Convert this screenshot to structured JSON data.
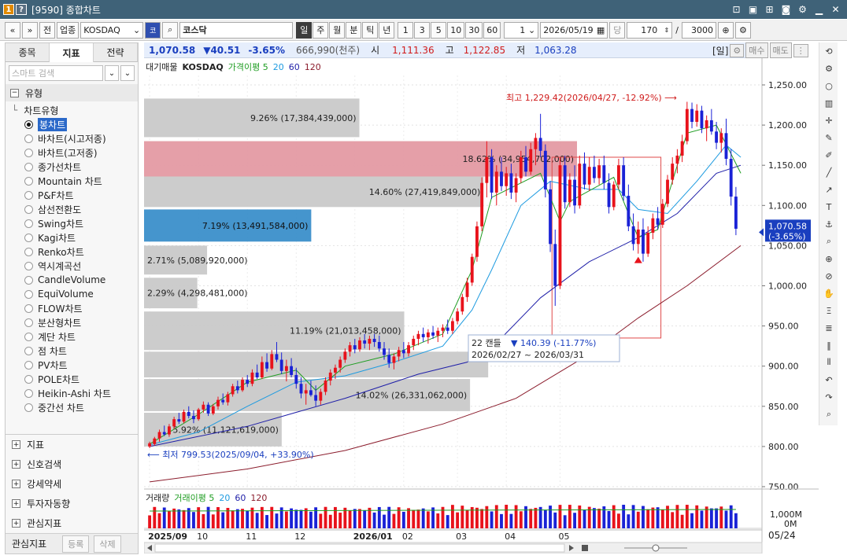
{
  "window": {
    "title": "[9590] 종합차트",
    "badge_one": "1",
    "badge_two": "?"
  },
  "toolbar": {
    "prev": "«",
    "next": "»",
    "all": "전",
    "sector": "업종",
    "symbol": "KOSDAQ",
    "code_btn": "코",
    "market_name": "코스닥",
    "periods": [
      "일",
      "주",
      "월",
      "분",
      "틱",
      "년"
    ],
    "active_period": "일",
    "intervals": [
      "1",
      "3",
      "5",
      "10",
      "30",
      "60"
    ],
    "count_select": "1",
    "date": "2026/05/19",
    "per_label": "당",
    "bar_count": "170",
    "slash": "/",
    "total_count": "3000"
  },
  "left_panel": {
    "tabs": [
      "종목",
      "지표",
      "전략"
    ],
    "active_tab": "지표",
    "search_placeholder": "스마트 검색",
    "section_title": "유형",
    "category": "차트유형",
    "chart_types": [
      "봉차트",
      "바차트(시고저종)",
      "바차트(고저종)",
      "종가선차트",
      "Mountain 차트",
      "P&F차트",
      "삼선전환도",
      "Swing차트",
      "Kagi차트",
      "Renko차트",
      "역시계곡선",
      "CandleVolume",
      "EquiVolume",
      "FLOW차트",
      "분산형차트",
      "계단 차트",
      "점 차트",
      "PV차트",
      "POLE차트",
      "Heikin-Ashi 차트",
      "중간선 차트"
    ],
    "selected_type": "봉차트",
    "groups": [
      "지표",
      "신호검색",
      "강세약세",
      "투자자동향",
      "관심지표"
    ],
    "bottom_label": "관심지표",
    "bottom_buttons": [
      "등록",
      "삭제"
    ]
  },
  "price_bar": {
    "last": "1,070.58",
    "change": "▼40.51",
    "change_pct": "-3.65%",
    "volume": "666,990(천주)",
    "open_label": "시",
    "open": "1,111.36",
    "high_label": "고",
    "high": "1,122.85",
    "low_label": "저",
    "low": "1,063.28",
    "period_tag": "[일]",
    "buy_label": "매수",
    "sell_label": "매도"
  },
  "legend": {
    "profile": "대기매물",
    "symbol": "KOSDAQ",
    "ma_label": "가격이평 5",
    "ma20": "20",
    "ma60": "60",
    "ma120": "120"
  },
  "volume_legend": {
    "title": "거래량",
    "ma_label": "거래이평 5",
    "ma20": "20",
    "ma60": "60",
    "ma120": "120"
  },
  "annotations": {
    "high": "최고 1,229.42(2026/04/27, -12.92%)",
    "low": "최저 799.53(2025/09/04, +33.90%)",
    "range_line1": "22 캔들",
    "range_change": "140.39 (-11.77%)",
    "range_line2": "2026/02/27 ~ 2026/03/31"
  },
  "last_price_tag": {
    "price": "1,070.58",
    "pct": "(-3.65%)"
  },
  "volume_axis": [
    "1,000M",
    "0M"
  ],
  "date_box": "05/24",
  "colors": {
    "up": "#e8121b",
    "down": "#1a22d6",
    "ma5": "#1f9d22",
    "ma20": "#1e9be0",
    "ma60": "#1f1fa8",
    "ma120": "#8b1c2c",
    "profile_gray": "#c9c9c9",
    "profile_red": "#e49aa3",
    "profile_blue": "#3b8fca"
  },
  "chart_data": {
    "type": "candlestick",
    "price_axis": {
      "min": 750,
      "max": 1250,
      "ticks": [
        750,
        800,
        850,
        900,
        950,
        1000,
        1050,
        1100,
        1150,
        1200,
        1250
      ]
    },
    "x_labels": [
      "2025/09",
      "10",
      "11",
      "12",
      "2026/01",
      "02",
      "03",
      "04",
      "05"
    ],
    "candles": [
      {
        "o": 800,
        "h": 806,
        "l": 798,
        "c": 804
      },
      {
        "o": 803,
        "h": 812,
        "l": 801,
        "c": 810
      },
      {
        "o": 810,
        "h": 821,
        "l": 806,
        "c": 818
      },
      {
        "o": 818,
        "h": 826,
        "l": 813,
        "c": 815
      },
      {
        "o": 815,
        "h": 828,
        "l": 812,
        "c": 825
      },
      {
        "o": 825,
        "h": 837,
        "l": 822,
        "c": 834
      },
      {
        "o": 834,
        "h": 842,
        "l": 828,
        "c": 831
      },
      {
        "o": 831,
        "h": 846,
        "l": 829,
        "c": 843
      },
      {
        "o": 843,
        "h": 850,
        "l": 835,
        "c": 838
      },
      {
        "o": 838,
        "h": 845,
        "l": 829,
        "c": 834
      },
      {
        "o": 834,
        "h": 848,
        "l": 832,
        "c": 846
      },
      {
        "o": 846,
        "h": 856,
        "l": 842,
        "c": 852
      },
      {
        "o": 852,
        "h": 855,
        "l": 838,
        "c": 841
      },
      {
        "o": 841,
        "h": 853,
        "l": 839,
        "c": 850
      },
      {
        "o": 850,
        "h": 862,
        "l": 846,
        "c": 858
      },
      {
        "o": 858,
        "h": 866,
        "l": 852,
        "c": 855
      },
      {
        "o": 855,
        "h": 868,
        "l": 851,
        "c": 865
      },
      {
        "o": 865,
        "h": 878,
        "l": 862,
        "c": 875
      },
      {
        "o": 875,
        "h": 882,
        "l": 866,
        "c": 870
      },
      {
        "o": 870,
        "h": 886,
        "l": 868,
        "c": 883
      },
      {
        "o": 883,
        "h": 889,
        "l": 874,
        "c": 878
      },
      {
        "o": 878,
        "h": 896,
        "l": 875,
        "c": 892
      },
      {
        "o": 892,
        "h": 902,
        "l": 884,
        "c": 886
      },
      {
        "o": 886,
        "h": 912,
        "l": 884,
        "c": 905
      },
      {
        "o": 905,
        "h": 916,
        "l": 893,
        "c": 897
      },
      {
        "o": 897,
        "h": 920,
        "l": 895,
        "c": 915
      },
      {
        "o": 915,
        "h": 930,
        "l": 905,
        "c": 908
      },
      {
        "o": 908,
        "h": 917,
        "l": 890,
        "c": 894
      },
      {
        "o": 894,
        "h": 908,
        "l": 881,
        "c": 900
      },
      {
        "o": 900,
        "h": 910,
        "l": 886,
        "c": 889
      },
      {
        "o": 889,
        "h": 898,
        "l": 872,
        "c": 878
      },
      {
        "o": 878,
        "h": 886,
        "l": 860,
        "c": 866
      },
      {
        "o": 866,
        "h": 878,
        "l": 852,
        "c": 870
      },
      {
        "o": 870,
        "h": 882,
        "l": 862,
        "c": 864
      },
      {
        "o": 864,
        "h": 876,
        "l": 850,
        "c": 857
      },
      {
        "o": 857,
        "h": 872,
        "l": 852,
        "c": 868
      },
      {
        "o": 868,
        "h": 886,
        "l": 864,
        "c": 882
      },
      {
        "o": 882,
        "h": 896,
        "l": 876,
        "c": 892
      },
      {
        "o": 892,
        "h": 902,
        "l": 884,
        "c": 898
      },
      {
        "o": 898,
        "h": 912,
        "l": 892,
        "c": 908
      },
      {
        "o": 908,
        "h": 922,
        "l": 904,
        "c": 918
      },
      {
        "o": 918,
        "h": 930,
        "l": 912,
        "c": 926
      },
      {
        "o": 926,
        "h": 934,
        "l": 916,
        "c": 921
      },
      {
        "o": 921,
        "h": 936,
        "l": 918,
        "c": 932
      },
      {
        "o": 932,
        "h": 940,
        "l": 922,
        "c": 928
      },
      {
        "o": 928,
        "h": 938,
        "l": 920,
        "c": 934
      },
      {
        "o": 934,
        "h": 940,
        "l": 924,
        "c": 930
      },
      {
        "o": 930,
        "h": 938,
        "l": 918,
        "c": 922
      },
      {
        "o": 922,
        "h": 930,
        "l": 908,
        "c": 914
      },
      {
        "o": 914,
        "h": 922,
        "l": 898,
        "c": 904
      },
      {
        "o": 904,
        "h": 916,
        "l": 896,
        "c": 912
      },
      {
        "o": 912,
        "h": 924,
        "l": 906,
        "c": 920
      },
      {
        "o": 920,
        "h": 930,
        "l": 910,
        "c": 916
      },
      {
        "o": 916,
        "h": 930,
        "l": 912,
        "c": 926
      },
      {
        "o": 926,
        "h": 938,
        "l": 920,
        "c": 934
      },
      {
        "o": 934,
        "h": 944,
        "l": 926,
        "c": 940
      },
      {
        "o": 940,
        "h": 948,
        "l": 930,
        "c": 936
      },
      {
        "o": 936,
        "h": 946,
        "l": 928,
        "c": 942
      },
      {
        "o": 942,
        "h": 950,
        "l": 934,
        "c": 938
      },
      {
        "o": 938,
        "h": 948,
        "l": 930,
        "c": 944
      },
      {
        "o": 944,
        "h": 952,
        "l": 936,
        "c": 948
      },
      {
        "o": 948,
        "h": 958,
        "l": 940,
        "c": 944
      },
      {
        "o": 944,
        "h": 960,
        "l": 940,
        "c": 956
      },
      {
        "o": 956,
        "h": 972,
        "l": 952,
        "c": 968
      },
      {
        "o": 968,
        "h": 990,
        "l": 964,
        "c": 986
      },
      {
        "o": 986,
        "h": 1010,
        "l": 980,
        "c": 1004
      },
      {
        "o": 1004,
        "h": 1040,
        "l": 1000,
        "c": 1036
      },
      {
        "o": 1036,
        "h": 1080,
        "l": 1030,
        "c": 1074
      },
      {
        "o": 1074,
        "h": 1135,
        "l": 1068,
        "c": 1128
      },
      {
        "o": 1128,
        "h": 1180,
        "l": 1110,
        "c": 1160
      },
      {
        "o": 1160,
        "h": 1170,
        "l": 1108,
        "c": 1116
      },
      {
        "o": 1116,
        "h": 1150,
        "l": 1100,
        "c": 1142
      },
      {
        "o": 1142,
        "h": 1160,
        "l": 1118,
        "c": 1124
      },
      {
        "o": 1124,
        "h": 1148,
        "l": 1112,
        "c": 1140
      },
      {
        "o": 1140,
        "h": 1152,
        "l": 1108,
        "c": 1116
      },
      {
        "o": 1116,
        "h": 1140,
        "l": 1104,
        "c": 1134
      },
      {
        "o": 1134,
        "h": 1168,
        "l": 1128,
        "c": 1160
      },
      {
        "o": 1160,
        "h": 1174,
        "l": 1136,
        "c": 1142
      },
      {
        "o": 1142,
        "h": 1178,
        "l": 1138,
        "c": 1170
      },
      {
        "o": 1170,
        "h": 1190,
        "l": 1150,
        "c": 1184
      },
      {
        "o": 1184,
        "h": 1214,
        "l": 1160,
        "c": 1168
      },
      {
        "o": 1168,
        "h": 1176,
        "l": 1110,
        "c": 1120
      },
      {
        "o": 1120,
        "h": 1130,
        "l": 1042,
        "c": 1052
      },
      {
        "o": 1052,
        "h": 1070,
        "l": 975,
        "c": 1000
      },
      {
        "o": 1000,
        "h": 1160,
        "l": 996,
        "c": 1150
      },
      {
        "o": 1150,
        "h": 1162,
        "l": 1096,
        "c": 1104
      },
      {
        "o": 1104,
        "h": 1140,
        "l": 1098,
        "c": 1132
      },
      {
        "o": 1132,
        "h": 1150,
        "l": 1090,
        "c": 1100
      },
      {
        "o": 1100,
        "h": 1162,
        "l": 1096,
        "c": 1152
      },
      {
        "o": 1152,
        "h": 1166,
        "l": 1120,
        "c": 1126
      },
      {
        "o": 1126,
        "h": 1160,
        "l": 1118,
        "c": 1148
      },
      {
        "o": 1148,
        "h": 1162,
        "l": 1128,
        "c": 1134
      },
      {
        "o": 1134,
        "h": 1158,
        "l": 1126,
        "c": 1150
      },
      {
        "o": 1150,
        "h": 1162,
        "l": 1120,
        "c": 1128
      },
      {
        "o": 1128,
        "h": 1140,
        "l": 1090,
        "c": 1098
      },
      {
        "o": 1098,
        "h": 1130,
        "l": 1094,
        "c": 1126
      },
      {
        "o": 1126,
        "h": 1158,
        "l": 1120,
        "c": 1150
      },
      {
        "o": 1150,
        "h": 1160,
        "l": 1106,
        "c": 1112
      },
      {
        "o": 1112,
        "h": 1126,
        "l": 1068,
        "c": 1074
      },
      {
        "o": 1074,
        "h": 1090,
        "l": 1044,
        "c": 1052
      },
      {
        "o": 1052,
        "h": 1080,
        "l": 1040,
        "c": 1070
      },
      {
        "o": 1070,
        "h": 1084,
        "l": 1030,
        "c": 1040
      },
      {
        "o": 1040,
        "h": 1074,
        "l": 1036,
        "c": 1066
      },
      {
        "o": 1066,
        "h": 1090,
        "l": 1058,
        "c": 1084
      },
      {
        "o": 1084,
        "h": 1098,
        "l": 1070,
        "c": 1076
      },
      {
        "o": 1076,
        "h": 1108,
        "l": 1072,
        "c": 1102
      },
      {
        "o": 1102,
        "h": 1138,
        "l": 1098,
        "c": 1132
      },
      {
        "o": 1132,
        "h": 1160,
        "l": 1126,
        "c": 1152
      },
      {
        "o": 1152,
        "h": 1170,
        "l": 1140,
        "c": 1162
      },
      {
        "o": 1162,
        "h": 1188,
        "l": 1154,
        "c": 1180
      },
      {
        "o": 1180,
        "h": 1229,
        "l": 1176,
        "c": 1220
      },
      {
        "o": 1220,
        "h": 1228,
        "l": 1196,
        "c": 1204
      },
      {
        "o": 1204,
        "h": 1226,
        "l": 1198,
        "c": 1218
      },
      {
        "o": 1218,
        "h": 1224,
        "l": 1190,
        "c": 1196
      },
      {
        "o": 1196,
        "h": 1212,
        "l": 1180,
        "c": 1206
      },
      {
        "o": 1206,
        "h": 1220,
        "l": 1188,
        "c": 1192
      },
      {
        "o": 1192,
        "h": 1204,
        "l": 1170,
        "c": 1178
      },
      {
        "o": 1178,
        "h": 1196,
        "l": 1166,
        "c": 1190
      },
      {
        "o": 1190,
        "h": 1208,
        "l": 1150,
        "c": 1158
      },
      {
        "o": 1158,
        "h": 1170,
        "l": 1100,
        "c": 1111
      },
      {
        "o": 1111,
        "h": 1123,
        "l": 1063,
        "c": 1071
      }
    ],
    "moving_averages": {
      "ma5": [
        [
          0,
          803
        ],
        [
          10,
          840
        ],
        [
          20,
          880
        ],
        [
          30,
          895
        ],
        [
          34,
          870
        ],
        [
          40,
          900
        ],
        [
          50,
          915
        ],
        [
          60,
          940
        ],
        [
          66,
          1020
        ],
        [
          70,
          1110
        ],
        [
          80,
          1140
        ],
        [
          84,
          1080
        ],
        [
          86,
          1105
        ],
        [
          95,
          1135
        ],
        [
          100,
          1060
        ],
        [
          104,
          1070
        ],
        [
          110,
          1190
        ],
        [
          116,
          1200
        ],
        [
          121,
          1140
        ]
      ],
      "ma20": [
        [
          0,
          802
        ],
        [
          10,
          818
        ],
        [
          20,
          850
        ],
        [
          30,
          880
        ],
        [
          40,
          888
        ],
        [
          50,
          905
        ],
        [
          60,
          925
        ],
        [
          66,
          970
        ],
        [
          70,
          1020
        ],
        [
          76,
          1100
        ],
        [
          82,
          1130
        ],
        [
          90,
          1120
        ],
        [
          96,
          1120
        ],
        [
          100,
          1095
        ],
        [
          106,
          1090
        ],
        [
          112,
          1130
        ],
        [
          118,
          1175
        ],
        [
          121,
          1160
        ]
      ],
      "ma60": [
        [
          0,
          800
        ],
        [
          20,
          825
        ],
        [
          40,
          860
        ],
        [
          55,
          890
        ],
        [
          65,
          905
        ],
        [
          72,
          935
        ],
        [
          80,
          985
        ],
        [
          90,
          1030
        ],
        [
          100,
          1060
        ],
        [
          108,
          1090
        ],
        [
          116,
          1140
        ],
        [
          121,
          1150
        ]
      ],
      "ma120": [
        [
          0,
          756
        ],
        [
          20,
          772
        ],
        [
          40,
          795
        ],
        [
          60,
          828
        ],
        [
          75,
          860
        ],
        [
          90,
          915
        ],
        [
          100,
          960
        ],
        [
          110,
          1000
        ],
        [
          121,
          1050
        ]
      ]
    },
    "volume_profile": [
      {
        "low": 1185,
        "high": 1233,
        "pct": 9.26,
        "volume": "17,384,439,000",
        "color": "gray"
      },
      {
        "low": 1136,
        "high": 1180,
        "pct": 18.62,
        "volume": "34,954,702,000",
        "color": "red"
      },
      {
        "low": 1098,
        "high": 1136,
        "pct": 14.6,
        "volume": "27,419,849,000",
        "color": "gray"
      },
      {
        "low": 1055,
        "high": 1095,
        "pct": 7.19,
        "volume": "13,491,584,000",
        "color": "blue"
      },
      {
        "low": 1014,
        "high": 1050,
        "pct": 2.71,
        "volume": "5,089,920,000",
        "color": "gray"
      },
      {
        "low": 972,
        "high": 1010,
        "pct": 2.29,
        "volume": "4,298,481,000",
        "color": "gray"
      },
      {
        "low": 920,
        "high": 968,
        "pct": 11.19,
        "volume": "21,013,458,000",
        "color": "gray"
      },
      {
        "low": 886,
        "high": 918,
        "pct": 14.8,
        "volume": "",
        "color": "gray"
      },
      {
        "low": 844,
        "high": 884,
        "pct": 14.02,
        "volume": "26,331,062,000",
        "color": "gray"
      },
      {
        "low": 800,
        "high": 842,
        "pct": 5.92,
        "volume": "11,121,619,000",
        "color": "gray"
      }
    ],
    "profile_labels": [
      "9.26% (17,384,439,000)",
      "18.62% (34,954,702,000)",
      "14.60% (27,419,849,000)",
      "7.19% (13,491,584,000)",
      "2.71% (5,089,920,000)",
      "2.29% (4,298,481,000)",
      "11.19% (21,013,458,000)",
      "",
      "14.02% (26,331,062,000)",
      "5.92% (11,121,619,000)"
    ]
  }
}
